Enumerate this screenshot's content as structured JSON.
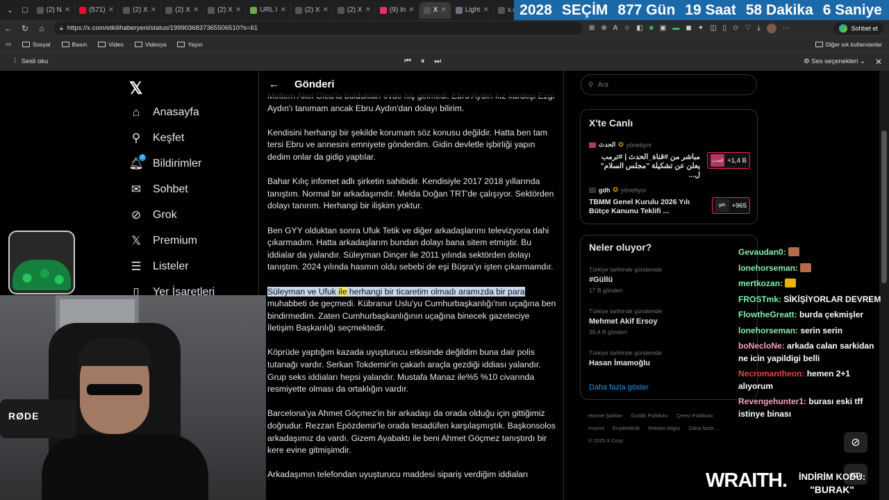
{
  "browser": {
    "tabs": [
      {
        "label": "(2) N",
        "color": "#555"
      },
      {
        "label": "(571)",
        "color": "#ff0033"
      },
      {
        "label": "(2) X",
        "color": "#555"
      },
      {
        "label": "(2) X",
        "color": "#555"
      },
      {
        "label": "(2) X",
        "color": "#555"
      },
      {
        "label": "URL I",
        "color": "#6aa84f"
      },
      {
        "label": "(2) X",
        "color": "#555"
      },
      {
        "label": "(2) X",
        "color": "#555"
      },
      {
        "label": "(9) In",
        "color": "#e1306c"
      },
      {
        "label": "X",
        "color": "#555"
      },
      {
        "label": "Light",
        "color": "#6b7280"
      },
      {
        "label": "x.com",
        "color": "#555"
      }
    ],
    "countdown": [
      "2028",
      "SEÇİM",
      "877 Gün",
      "19 Saat",
      "58 Dakika",
      "6 Saniye"
    ],
    "url": "https://x.com/etkilihaberyeni/status/1999036837365506510?s=61",
    "chat_button": "Sohbet et",
    "bookmarks": [
      "Sosyal",
      "Basın",
      "Video",
      "Videoya",
      "Yayın"
    ],
    "bookmarks_right": "Diğer sık kullanılanlar",
    "read_aloud": "Sesli oku",
    "voice_options": "Ses seçenekleri"
  },
  "nav": {
    "items": [
      "Anasayfa",
      "Keşfet",
      "Bildirimler",
      "Sohbet",
      "Grok",
      "Premium",
      "Listeler",
      "Yer İşaretleri"
    ],
    "badge": "2"
  },
  "post": {
    "header": "Gönderi",
    "paragraphs": [
      "Meltem Akel Olea'la buldukları evde hiç gelmedi. Ebru Aydın kız kardeşi Ezgi Aydın'ı tanımam ancak Ebru Aydın'dan dolayı bilirim.",
      "Kendisini herhangi bir şekilde korumam söz konusu değildir. Hatta ben tam tersi Ebru ve annesini emniyete gönderdim. Gidin devletle işbirliği yapın dedim onlar da gidip yaptılar.",
      "Bahar Kılıç infomet adlı şirketin sahibidir. Kendisiyle 2017 2018 yıllarında tanıştım. Normal bir arkadaşımdır. Melda Doğan TRT'de çalışıyor. Sektörden dolayı tanırım. Herhangi bir ilişkim yoktur.",
      "Ben GYY olduktan sonra Ufuk Tetik ve diğer arkadaşlarımı televizyona dahi çıkarmadım. Hatta arkadaşlarım bundan dolayı bana sitem etmiştir. Bu iddialar da yalandır. Süleyman Dinçer ile 2011 yılında sektörden dolayı tanıştım. 2024 yılında hasmın oldu sebebi de eşi Büşra'yı işten çıkarmamdır."
    ],
    "highlight_a": "Süleyman ve Ufuk ",
    "highlight_word": "ile",
    "highlight_b": " herhangi bir ticaretim olmadı aramızda bir para",
    "highlight_rest": " muhabbeti de geçmedi. Kübranur Uslu'yu Cumhurbaşkanlığı'nın uçağına ben bindirmedim. Zaten Cumhurbaşkanlığının uçağına binecek gazeteciye İletişim Başkanlığı seçmektedir.",
    "paragraphs2": [
      "Köprüde yaptığım kazada uyuşturucu etkisinde değildim buna dair polis tutanağı vardır. Serkan Tokdemir'in çakarlı araçla gezdiği iddiası yalandır. Grup seks iddiaları hepsi yalandır. Mustafa Manaz ile%5 %10 civarında resmiyette olması da ortaklığın vardır.",
      "Barcelona'ya Ahmet Göçmez'in bir arkadaşı da orada olduğu için gittiğimiz doğrudur. Rezzan Epözdemir'le orada tesadüfen karşılaşmıştık. Başkonsolos arkadaşımız da vardı. Gizem Ayabaktı ile beni Ahmet Göçmez tanıştırdı bir kere evine gitmişimdir.",
      "Arkadaşımın telefondan uyuşturucu maddesi sipariş verdiğim iddiaları"
    ]
  },
  "right": {
    "search_placeholder": "Ara",
    "live_title": "X'te Canlı",
    "live": [
      {
        "account": "الحدث",
        "role": "yönetiyor",
        "text": "مباشر من #قناة_الحدث | #ترمب يعلن عن تشكيلة \"مجلس السلام\" ل...",
        "count": "+1,4 B",
        "avatar": "الحدث"
      },
      {
        "account": "gdh",
        "role": "yönetiyor",
        "text": "TBMM Genel Kurulu 2026 Yılı Bütçe Kanunu Teklifi ...",
        "count": "+965",
        "avatar": "gdh"
      }
    ],
    "trends_title": "Neler oluyor?",
    "trends": [
      {
        "context": "Türkiye tarihinde gündemde",
        "name": "#Güllü",
        "count": "17 B gönderi"
      },
      {
        "context": "Türkiye tarihinde gündemde",
        "name": "Mehmet Akif Ersoy",
        "count": "39,4 B gönderi"
      },
      {
        "context": "Türkiye tarihinde gündemde",
        "name": "Hasan İmamoğlu",
        "count": ""
      }
    ],
    "more": "Daha fazla göster",
    "footer": [
      "Hizmet Şartları",
      "Gizlilik Politikası",
      "Çerez Politikası",
      "Imprint",
      "Erişilebilirlik",
      "Reklam bilgisi",
      "Daha fazla ...",
      "© 2025 X Corp."
    ]
  },
  "stream": {
    "chat": [
      {
        "user": "Gevaudan0:",
        "msg": "",
        "emote": true,
        "cls": "green"
      },
      {
        "user": "lonehorseman:",
        "msg": "",
        "emote": true,
        "cls": "green"
      },
      {
        "user": "mertkozan:",
        "msg": "",
        "emote": true,
        "cls": "green"
      },
      {
        "user": "FROSTmk:",
        "msg": "SİKİŞİYORLAR DEVREM",
        "emote": false,
        "cls": "green"
      },
      {
        "user": "FlowtheGreatt:",
        "msg": "burda çekmişler",
        "emote": false,
        "cls": "green"
      },
      {
        "user": "lonehorseman:",
        "msg": "serin serin",
        "emote": false,
        "cls": "green"
      },
      {
        "user": "boNecloNe:",
        "msg": "arkada calan sarkidan ne icin yapildigi belli",
        "emote": false,
        "cls": "pink"
      },
      {
        "user": "Necromantheon:",
        "msg": "hemen 2+1 alıyorum",
        "emote": false,
        "cls": "red"
      },
      {
        "user": "Revengehunter1:",
        "msg": "burası eski tff istinye binası",
        "emote": false,
        "cls": "pink"
      }
    ],
    "brand": "WRAITH.",
    "promo_line1": "İNDİRİM KODU:",
    "promo_line2": "\"BURAK\"",
    "mic_label": "RØDE"
  },
  "colors": {
    "accent": "#1d9bf0",
    "live_border": "#f91880",
    "countdown_bg": "#1b69a8"
  }
}
